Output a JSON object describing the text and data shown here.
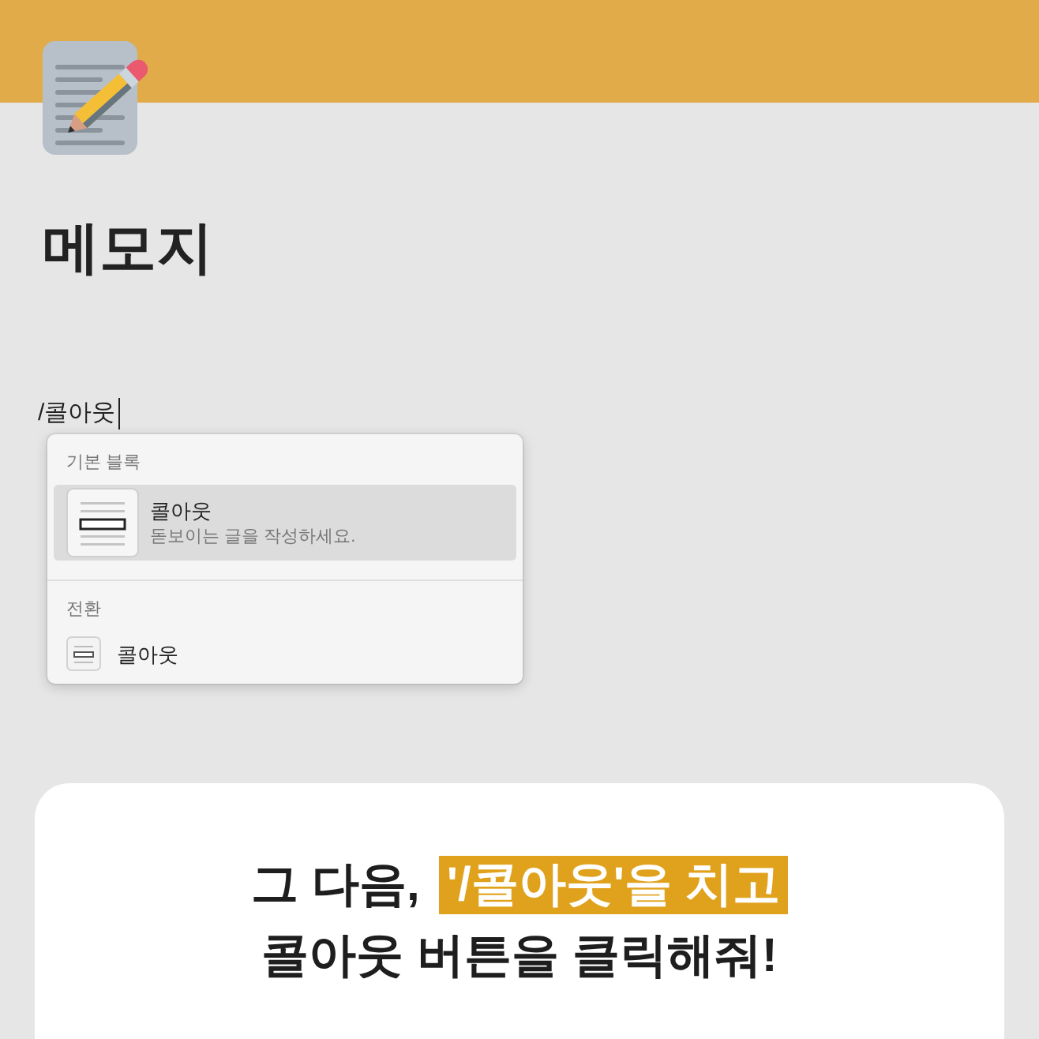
{
  "page": {
    "title": "메모지"
  },
  "editor": {
    "value": "/콜아웃",
    "focused": true
  },
  "menu": {
    "sections": [
      {
        "label": "기본 블록",
        "items": [
          {
            "kind": "large",
            "title": "콜아웃",
            "description": "돋보이는 글을 작성하세요.",
            "selected": true
          }
        ]
      },
      {
        "label": "전환",
        "items": [
          {
            "kind": "small",
            "title": "콜아웃",
            "selected": false
          }
        ]
      }
    ]
  },
  "caption": {
    "lines": [
      {
        "segments": [
          {
            "text": "그 다음,",
            "highlighted": false
          },
          {
            "text": "'/콜아웃'을 치고",
            "highlighted": true
          }
        ]
      },
      {
        "segments": [
          {
            "text": "콜아웃 버튼을 클릭해줘!",
            "highlighted": false
          }
        ]
      }
    ]
  }
}
